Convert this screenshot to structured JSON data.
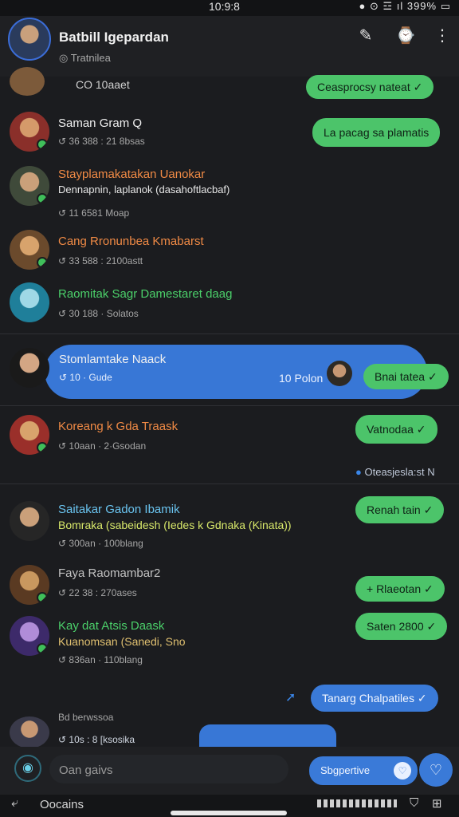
{
  "status": {
    "time": "10:9:8",
    "icons": "● ⊙ ☲ ıl 399% ▭"
  },
  "header": {
    "title": "Batbill Igepardan",
    "subtitle": "Tratnilea"
  },
  "rows": [
    {
      "name": "CO 10aaet",
      "meta": "",
      "pill": "Ceasprocsy nateat ✓"
    },
    {
      "name": "Saman Gram Q",
      "meta": "↺ 36 388 : 21 8bsas",
      "pill": "La pacag sa plamatis"
    },
    {
      "name": "Stayplamakatakan Uanokar",
      "name2": "Dennapnin, laplanok (dasahoftlacbaf)",
      "meta": "↺ 11 6581 Moap"
    },
    {
      "name": "Cang Rronunbea Kmabarst",
      "meta": "↺ 33 588 : 2100astt"
    },
    {
      "name": "Raomitak Sagr Damestaret daag",
      "meta": "↺ 30 188 · Solatos"
    },
    {
      "name": "Stomlamtake Naack",
      "meta": "↺ 10 · Gude",
      "right": "10 Polon",
      "pill": "Bnai tatea ✓"
    },
    {
      "name": "Koreang k Gda Traask",
      "meta": "↺ 10aan · 2·Gsodan",
      "pill": "Vatnodaa ✓"
    },
    {
      "status": "Oteasjesla:st N"
    },
    {
      "name": "Saitakar Gadon Ibamik",
      "name2": "Bomraka (sabeidesh (Iedes k Gdnaka (Kinata))",
      "meta": "↺ 300an · 100blang",
      "pill": "Renah tain ✓"
    },
    {
      "name": "Faya Raomambar2",
      "meta": "↺ 22 38 : 270ases",
      "pill": "+ Rlaeotan ✓"
    },
    {
      "name": "Kay dat Atsis Daask",
      "name2": "Kuanomsan (Sanedi, Sno",
      "meta": "↺ 836an · 110blang",
      "pill": "Saten 2800 ✓"
    },
    {
      "pill": "Tanarg Chalpatiles ✓"
    },
    {
      "name": "Bd berwssoa",
      "meta": "↺ 10s : 8 [ksosika"
    }
  ],
  "compose": {
    "placeholder": "Oan gaivs",
    "suggest": "Sbgpertive"
  },
  "nav": {
    "label": "Oocains"
  }
}
